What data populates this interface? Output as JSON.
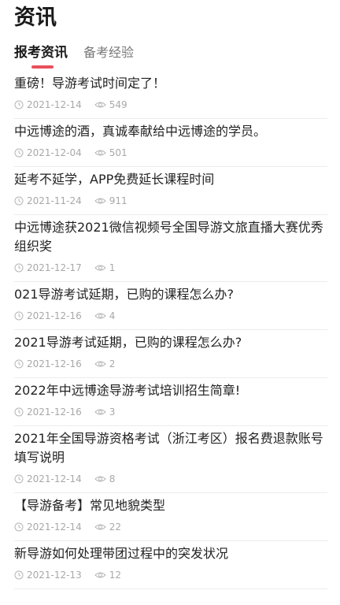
{
  "header": {
    "title": "资讯"
  },
  "tabs": [
    {
      "label": "报考资讯",
      "active": true
    },
    {
      "label": "备考经验",
      "active": false
    }
  ],
  "accent_color": "#e8505b",
  "icons": {
    "date": "clock-icon",
    "views": "eye-icon"
  },
  "articles": [
    {
      "title": "重磅！导游考试时间定了！",
      "date": "2021-12-14",
      "views": "549"
    },
    {
      "title": "中远博途的酒，真诚奉献给中远博途的学员。",
      "date": "2021-12-04",
      "views": "501"
    },
    {
      "title": "延考不延学，APP免费延长课程时间",
      "date": "2021-11-24",
      "views": "911"
    },
    {
      "title": "中远博途获2021微信视频号全国导游文旅直播大赛优秀组织奖",
      "date": "2021-12-17",
      "views": "1"
    },
    {
      "title": "021导游考试延期，已购的课程怎么办?",
      "date": "2021-12-16",
      "views": "4"
    },
    {
      "title": "2021导游考试延期，已购的课程怎么办?",
      "date": "2021-12-16",
      "views": "2"
    },
    {
      "title": "2022年中远博途导游考试培训招生简章!",
      "date": "2021-12-16",
      "views": "3"
    },
    {
      "title": "2021年全国导游资格考试（浙江考区）报名费退款账号填写说明",
      "date": "2021-12-14",
      "views": "8"
    },
    {
      "title": "【导游备考】常见地貌类型",
      "date": "2021-12-14",
      "views": "22"
    },
    {
      "title": "新导游如何处理带团过程中的突发状况",
      "date": "2021-12-13",
      "views": "12"
    }
  ]
}
